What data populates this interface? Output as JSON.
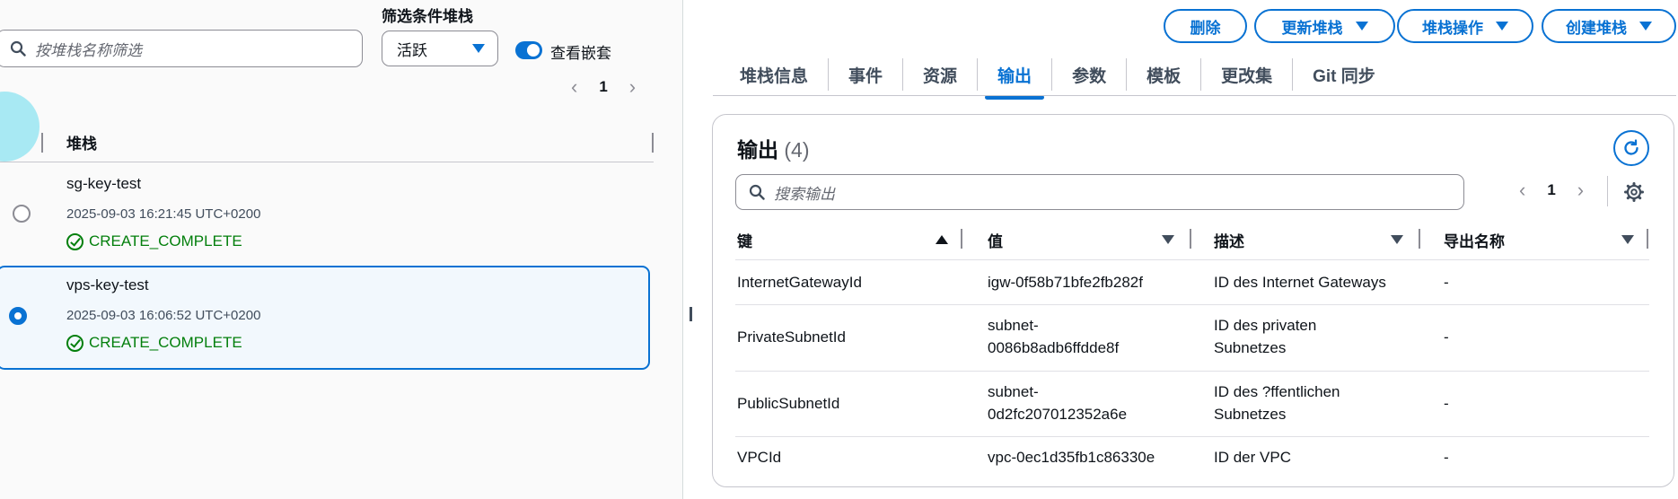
{
  "left": {
    "search_placeholder": "按堆栈名称筛选",
    "filter_label": "筛选条件堆栈",
    "filter_value": "活跃",
    "toggle_label": "查看嵌套",
    "page": "1",
    "column_header": "堆栈",
    "stacks": [
      {
        "name": "sg-key-test",
        "time": "2025-09-03 16:21:45 UTC+0200",
        "status": "CREATE_COMPLETE",
        "selected": false
      },
      {
        "name": "vps-key-test",
        "time": "2025-09-03 16:06:52 UTC+0200",
        "status": "CREATE_COMPLETE",
        "selected": true
      }
    ]
  },
  "actions": {
    "delete": "删除",
    "update": "更新堆栈",
    "stack_actions": "堆栈操作",
    "create": "创建堆栈"
  },
  "tabs": [
    "堆栈信息",
    "事件",
    "资源",
    "输出",
    "参数",
    "模板",
    "更改集",
    "Git 同步"
  ],
  "active_tab": "输出",
  "outputs": {
    "title": "输出",
    "count": "(4)",
    "search_placeholder": "搜索输出",
    "page": "1",
    "columns": [
      "键",
      "值",
      "描述",
      "导出名称"
    ],
    "rows": [
      {
        "key": "InternetGatewayId",
        "value": "igw-0f58b71bfe2fb282f",
        "desc": "ID des Internet Gateways",
        "export": "-"
      },
      {
        "key": "PrivateSubnetId",
        "value_1": "subnet-",
        "value_2": "0086b8adb6ffdde8f",
        "desc_1": "ID des privaten",
        "desc_2": "Subnetzes",
        "export": "-"
      },
      {
        "key": "PublicSubnetId",
        "value_1": "subnet-",
        "value_2": "0d2fc207012352a6e",
        "desc_1": "ID des ?ffentlichen",
        "desc_2": "Subnetzes",
        "export": "-"
      },
      {
        "key": "VPCId",
        "value": "vpc-0ec1d35fb1c86330e",
        "desc": "ID der VPC",
        "export": "-"
      }
    ]
  },
  "colors": {
    "accent": "#0972d3",
    "success": "#037f0c",
    "highlight": "#9fe7f2"
  }
}
